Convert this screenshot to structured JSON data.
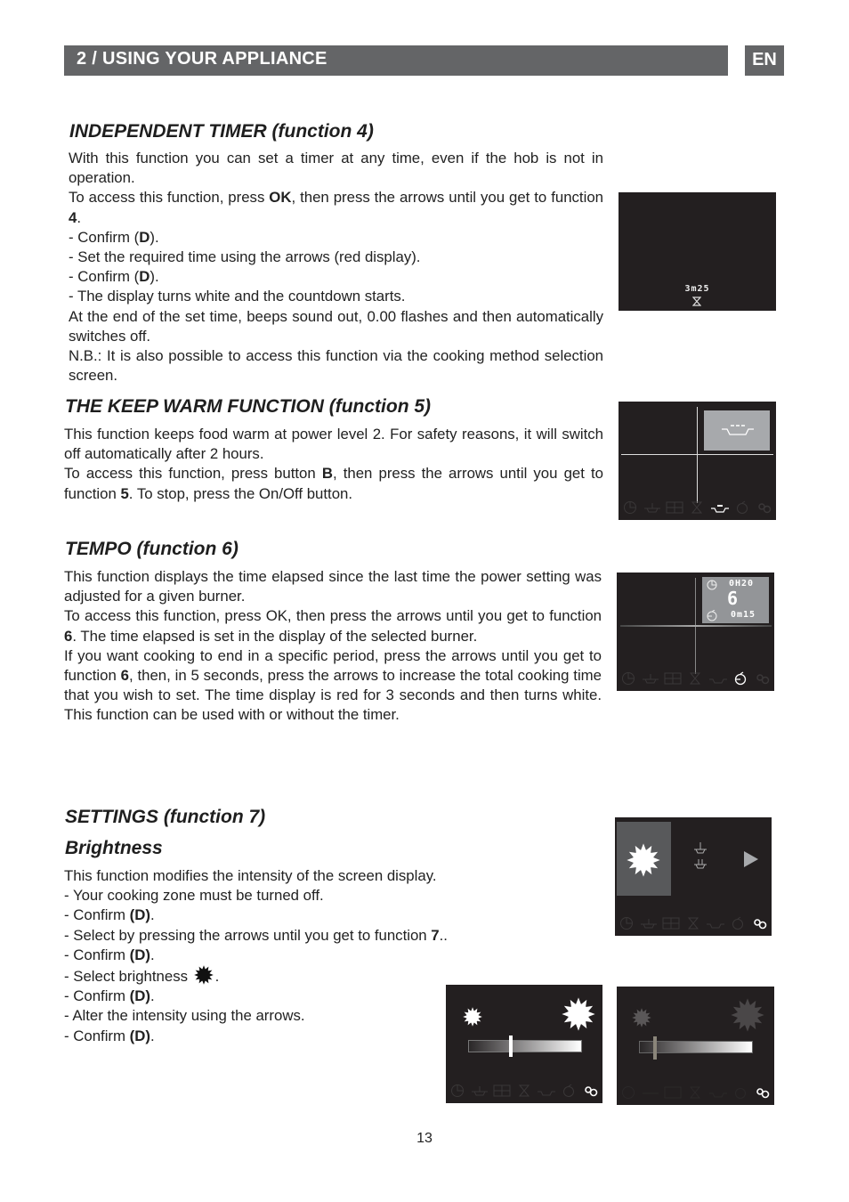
{
  "header": {
    "section_title": "2 / USING YOUR APPLIANCE",
    "language": "EN"
  },
  "sections": {
    "timer": {
      "title": "INDEPENDENT TIMER (function 4)",
      "lines": [
        "With this function you can set a timer at any time, even if the hob is not in operation.",
        "To access this function, press ",
        "OK",
        ", then press the arrows until you get to function ",
        "4",
        ".",
        "- Confirm (",
        "D",
        ").",
        "- Set the required time using the arrows (red display).",
        "- The display turns white and the countdown starts.",
        "At the end of the set time, beeps sound out, 0.00 flashes and then automatically switches off.",
        "N.B.: It is also possible to access this function via the cooking method selection screen."
      ],
      "display": {
        "countdown": "3m25",
        "icon": "hourglass-icon"
      }
    },
    "keep_warm": {
      "title": "THE KEEP WARM FUNCTION (function 5)",
      "lines": [
        "This function keeps food warm at power level 2. For safety reasons, it will switch off automatically after 2 hours.",
        "To access this function, press button ",
        "B",
        ", then press the arrows until you get to function ",
        "5",
        ". To stop, press the On/Off button."
      ]
    },
    "tempo": {
      "title": "TEMPO (function 6)",
      "lines": [
        "This function displays the time elapsed since the last time the power setting was adjusted for a given burner.",
        "To access this function, press OK, then press the arrows until you get to function ",
        "6",
        ". The time elapsed is set in the display of the selected burner.",
        "If you want cooking to end in a specific period, press the arrows until you get to function ",
        "6",
        ", then, in 5 seconds, press the arrows to increase the total cooking time that you wish to set. The time display is red for 3 seconds and then turns white. This function can be used with or without the timer."
      ],
      "display": {
        "elapsed": "0H20",
        "level": "6",
        "remaining": "0m15"
      }
    },
    "settings": {
      "title": "SETTINGS (function 7)",
      "subtitle": "Brightness",
      "lines": [
        "This function modifies the intensity of the screen display.",
        "- Your cooking zone must be turned off.",
        "- Confirm ",
        "(D)",
        ".",
        "- Select by pressing the arrows until you get to function ",
        "7",
        "..",
        "- Select brightness ",
        "- Alter the intensity using the arrows."
      ],
      "brightness_levels": [
        0.37,
        0.12
      ]
    }
  },
  "footer": {
    "page_number": "13"
  }
}
